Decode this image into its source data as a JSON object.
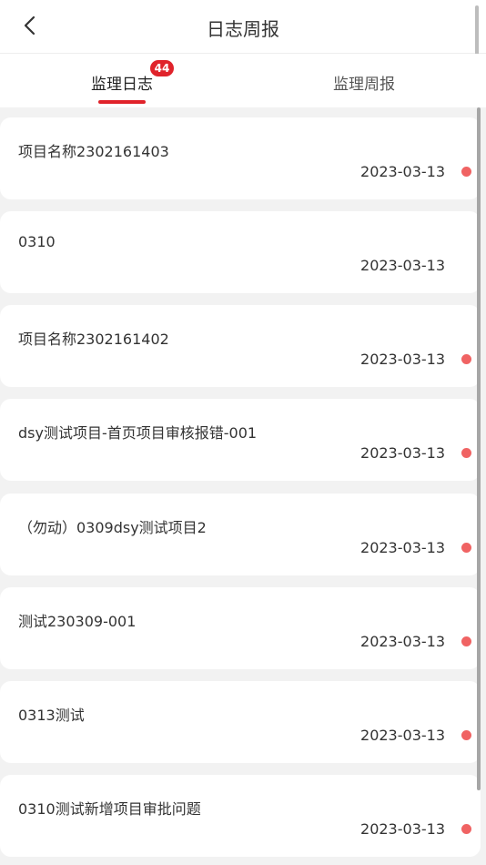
{
  "header": {
    "title": "日志周报"
  },
  "tabs": [
    {
      "label": "监理日志",
      "badge": "44",
      "active": true
    },
    {
      "label": "监理周报",
      "active": false
    }
  ],
  "records": [
    {
      "title": "项目名称2302161403",
      "date": "2023-03-13",
      "unread": true
    },
    {
      "title": "0310",
      "date": "2023-03-13",
      "unread": false
    },
    {
      "title": "项目名称2302161402",
      "date": "2023-03-13",
      "unread": true
    },
    {
      "title": "dsy测试项目-首页项目审核报错-001",
      "date": "2023-03-13",
      "unread": true
    },
    {
      "title": "（勿动）0309dsy测试项目2",
      "date": "2023-03-13",
      "unread": true
    },
    {
      "title": "测试230309-001",
      "date": "2023-03-13",
      "unread": true
    },
    {
      "title": "0313测试",
      "date": "2023-03-13",
      "unread": true
    },
    {
      "title": "0310测试新增项目审批问题",
      "date": "2023-03-13",
      "unread": true
    }
  ],
  "colors": {
    "accent": "#e0232b",
    "unread_dot": "#f06363"
  }
}
